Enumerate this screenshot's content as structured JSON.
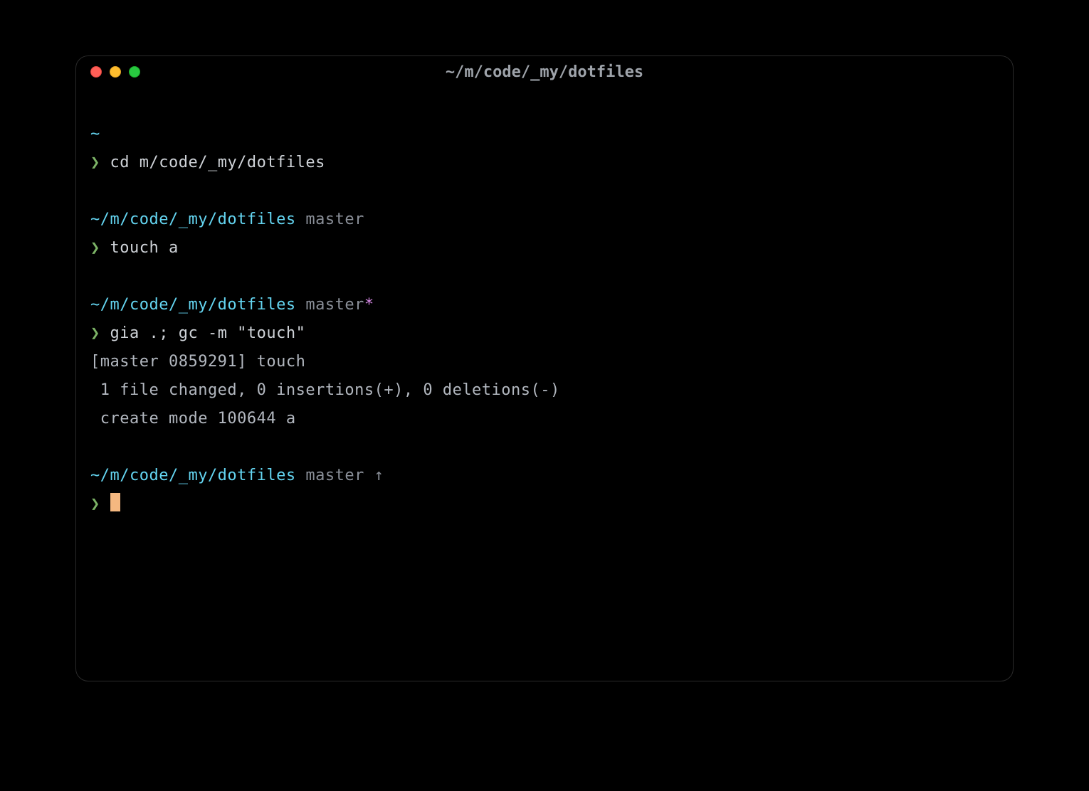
{
  "window": {
    "title": "~/m/code/_my/dotfiles"
  },
  "blocks": [
    {
      "path": "~",
      "branch": "",
      "dirty": "",
      "arrow": "",
      "command": "cd m/code/_my/dotfiles",
      "output": []
    },
    {
      "path": "~/m/code/_my/dotfiles",
      "branch": "master",
      "dirty": "",
      "arrow": "",
      "command": "touch a",
      "output": []
    },
    {
      "path": "~/m/code/_my/dotfiles",
      "branch": "master",
      "dirty": "*",
      "arrow": "",
      "command": "gia .; gc -m \"touch\"",
      "output": [
        "[master 0859291] touch",
        " 1 file changed, 0 insertions(+), 0 deletions(-)",
        " create mode 100644 a"
      ]
    },
    {
      "path": "~/m/code/_my/dotfiles",
      "branch": "master",
      "dirty": "",
      "arrow": "↑",
      "command": "",
      "output": []
    }
  ],
  "prompt_symbol": "❯"
}
